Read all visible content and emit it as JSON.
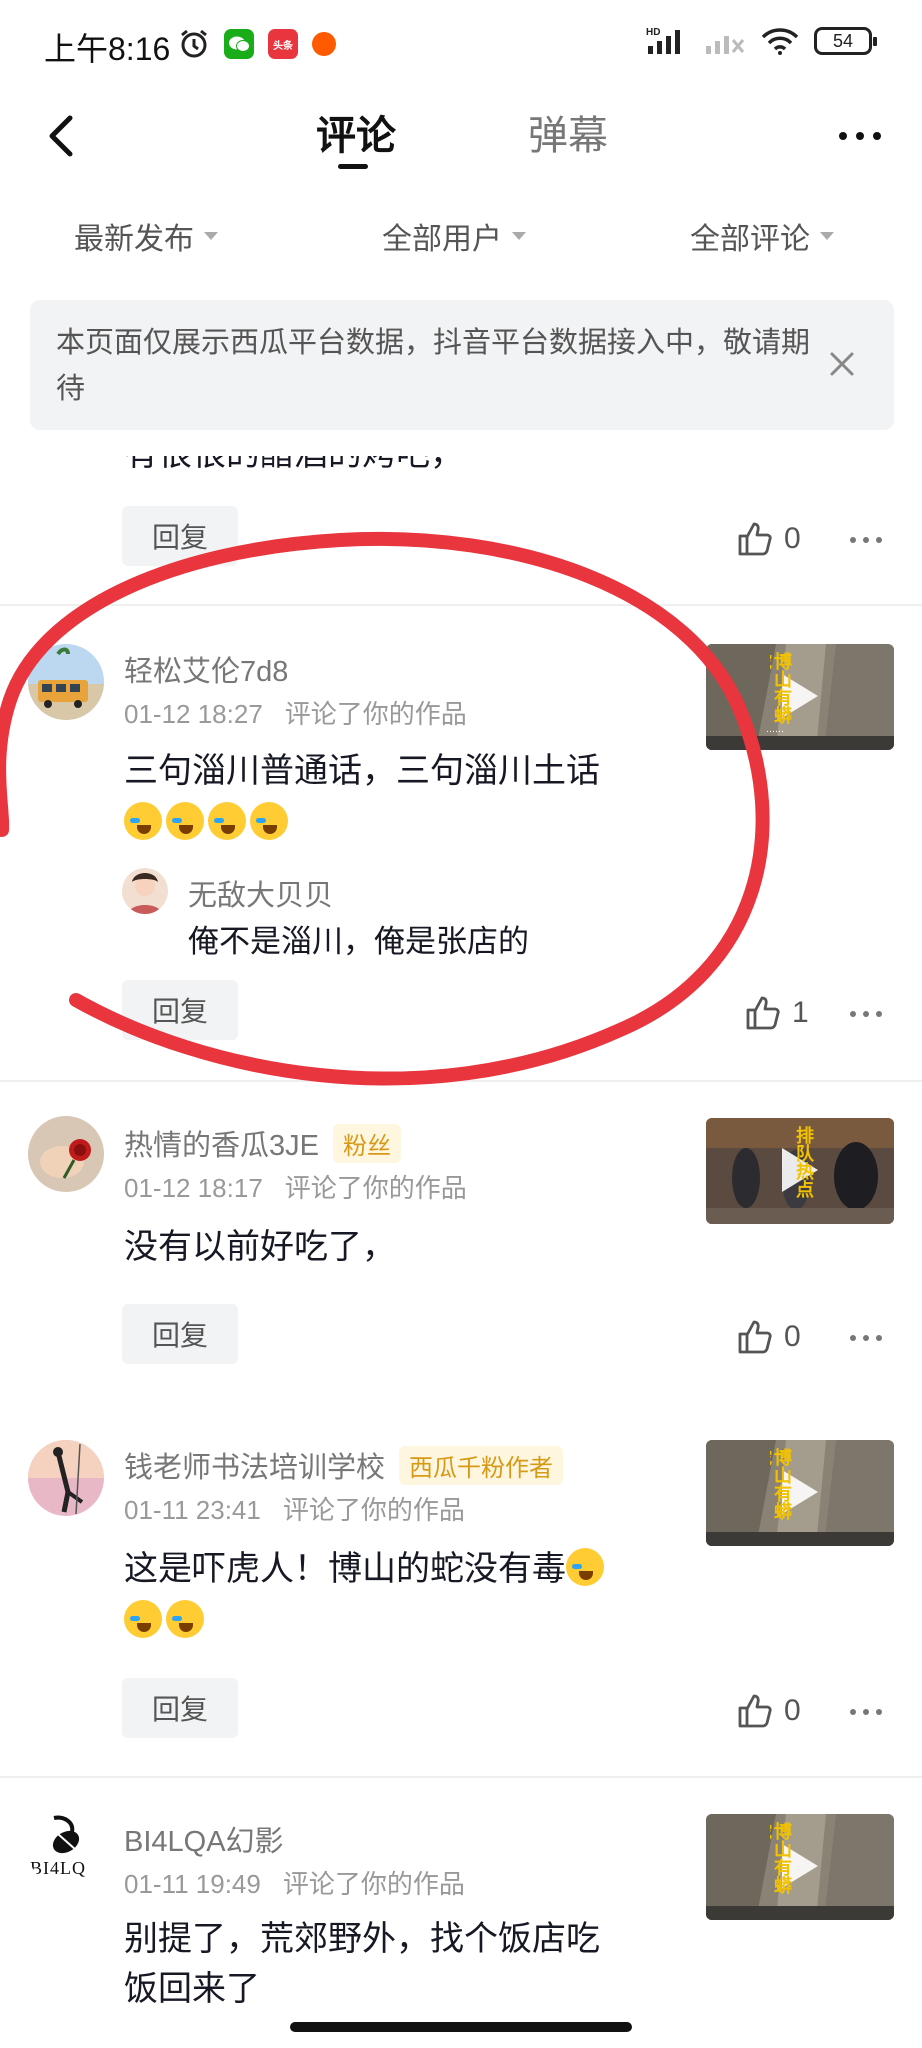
{
  "status": {
    "time": "上午8:16",
    "battery": "54",
    "hd": "HD"
  },
  "nav": {
    "tabs": [
      {
        "label": "评论"
      },
      {
        "label": "弹幕"
      }
    ]
  },
  "filters": [
    {
      "label": "最新发布"
    },
    {
      "label": "全部用户"
    },
    {
      "label": "全部评论"
    }
  ],
  "notice": {
    "text": "本页面仅展示西瓜平台数据，抖音平台数据接入中，敬请期待"
  },
  "partial_comment": {
    "text": "有很很的醋酒的烤吧，",
    "reply_label": "回复",
    "likes": "0"
  },
  "comments": [
    {
      "user": "轻松艾伦7d8",
      "time": "01-12 18:27",
      "action": "评论了你的作品",
      "text": "三句淄川普通话，三句淄川土话",
      "reply": {
        "user": "无敌大贝贝",
        "text": "俺不是淄川，俺是张店的"
      },
      "reply_label": "回复",
      "likes": "1"
    },
    {
      "user": "热情的香瓜3JE",
      "badge": "粉丝",
      "time": "01-12 18:17",
      "action": "评论了你的作品",
      "text": "没有以前好吃了，",
      "reply_label": "回复",
      "likes": "0"
    },
    {
      "user": "钱老师书法培训学校",
      "badge": "西瓜千粉作者",
      "time": "01-11 23:41",
      "action": "评论了你的作品",
      "text": "这是吓虎人！博山的蛇没有毒",
      "reply_label": "回复",
      "likes": "0"
    },
    {
      "user": "BI4LQA幻影",
      "avatar_text": "BI4LQ",
      "time": "01-11 19:49",
      "action": "评论了你的作品",
      "text_line1": "别提了，荒郊野外，找个饭店吃",
      "text_line2": "饭回来了"
    }
  ],
  "thumb_texts": {
    "t1": "博山有蟒蛇",
    "t2": "排队热点"
  },
  "colors": {
    "annotation_red": "#e8353e",
    "badge_text": "#d69a17"
  }
}
